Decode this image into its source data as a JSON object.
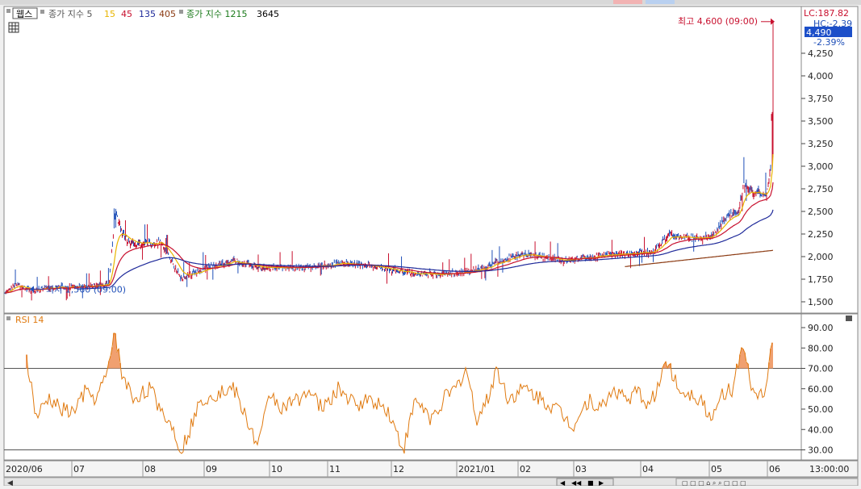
{
  "legend": {
    "stock": "웹스",
    "ma_label": "종가 지수 5",
    "ma": [
      {
        "period": "15",
        "color": "#e8b500"
      },
      {
        "period": "45",
        "color": "#c8102e"
      },
      {
        "period": "135",
        "color": "#1f2a9a"
      },
      {
        "period": "405",
        "color": "#8b3a12"
      }
    ],
    "ma2_label": "종가 지수 1215",
    "ma2_extra": "3645",
    "ma2_color": "#1a7a1a"
  },
  "price_panel": {
    "right_info": [
      "LC:187.82",
      "HC:-2.39",
      "-2.39%"
    ],
    "current_price": "4,490",
    "y_ticks": [
      1500,
      1750,
      2000,
      2250,
      2500,
      2750,
      3000,
      3250,
      3500,
      3750,
      4000,
      4250
    ],
    "y_tick_labels": [
      "1,500",
      "1,750",
      "2,000",
      "2,250",
      "2,500",
      "2,750",
      "3,000",
      "3,250",
      "3,500",
      "3,750",
      "4,000",
      "4,250"
    ],
    "high_label": "최고 4,600 (09:00)",
    "low_label": "최저 1,560 (09:00)",
    "high_value": 4600,
    "low_value": 1560
  },
  "rsi_panel": {
    "title": "RSI 14",
    "y_ticks": [
      30,
      40,
      50,
      60,
      70,
      80,
      90
    ],
    "y_tick_labels": [
      "30.00",
      "40.00",
      "50.00",
      "60.00",
      "70.00",
      "80.00",
      "90.00"
    ],
    "overbought": 70,
    "oversold": 30
  },
  "x_axis": {
    "labels": [
      "2020/06",
      "07",
      "08",
      "09",
      "10",
      "11",
      "12",
      "2021/01",
      "02",
      "03",
      "04",
      "05",
      "06"
    ],
    "time_label": "13:00:00"
  },
  "colors": {
    "up": "#c8102e",
    "down": "#1f4fb8",
    "ma15": "#e8b500",
    "ma45": "#c8102e",
    "ma135": "#1f2a9a",
    "ma405": "#8b3a12",
    "rsi": "#e07a10",
    "rsi_fill": "#f0a070",
    "current": "#1c4fc9"
  },
  "chart_data": {
    "type": "line",
    "title": "",
    "x": [
      "2020/06",
      "07",
      "08",
      "09",
      "10",
      "11",
      "12",
      "2021/01",
      "02",
      "03",
      "04",
      "05",
      "06"
    ],
    "ylim": [
      1450,
      4700
    ],
    "series": [
      {
        "name": "웹스",
        "values": [
          1600,
          1670,
          2080,
          1900,
          1900,
          1920,
          1840,
          1800,
          2000,
          1990,
          2100,
          2450,
          4490
        ]
      },
      {
        "name": "15",
        "values": [
          1620,
          1660,
          1980,
          1930,
          1910,
          1910,
          1860,
          1810,
          1960,
          1990,
          2080,
          2400,
          3200
        ]
      },
      {
        "name": "45",
        "values": [
          1650,
          1660,
          1950,
          1940,
          1920,
          1910,
          1880,
          1830,
          1930,
          1980,
          2050,
          2300,
          2700
        ]
      },
      {
        "name": "135",
        "values": [
          null,
          1700,
          1850,
          1880,
          1900,
          1910,
          1890,
          1860,
          1890,
          1940,
          2000,
          2150,
          2380
        ]
      },
      {
        "name": "405",
        "values": [
          null,
          null,
          null,
          null,
          null,
          null,
          null,
          null,
          null,
          null,
          1890,
          1950,
          2070
        ]
      }
    ],
    "rsi": {
      "name": "RSI 14",
      "x": [
        "2020/06",
        "07",
        "08",
        "09",
        "10",
        "11",
        "12",
        "2021/01",
        "02",
        "03",
        "04",
        "05",
        "06"
      ],
      "values": [
        75,
        50,
        90,
        30,
        55,
        55,
        45,
        65,
        55,
        50,
        60,
        60,
        88
      ],
      "ylim": [
        25,
        95
      ]
    }
  }
}
